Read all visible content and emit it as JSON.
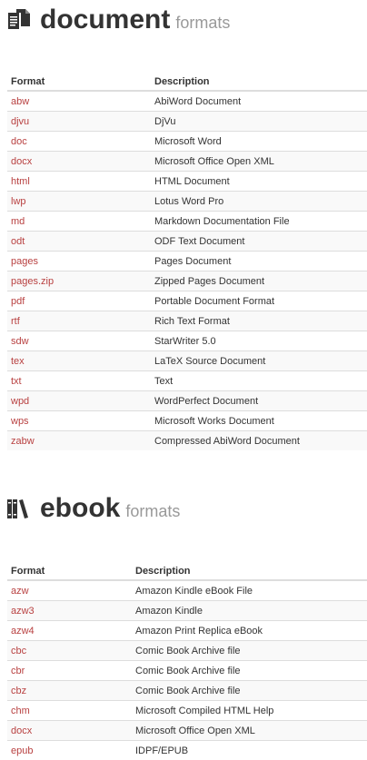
{
  "document": {
    "title": "document",
    "subtitle": "formats",
    "header_format": "Format",
    "header_description": "Description",
    "rows": [
      {
        "format": "abw",
        "description": "AbiWord Document"
      },
      {
        "format": "djvu",
        "description": "DjVu"
      },
      {
        "format": "doc",
        "description": "Microsoft Word"
      },
      {
        "format": "docx",
        "description": "Microsoft Office Open XML"
      },
      {
        "format": "html",
        "description": "HTML Document"
      },
      {
        "format": "lwp",
        "description": "Lotus Word Pro"
      },
      {
        "format": "md",
        "description": "Markdown Documentation File"
      },
      {
        "format": "odt",
        "description": "ODF Text Document"
      },
      {
        "format": "pages",
        "description": "Pages Document"
      },
      {
        "format": "pages.zip",
        "description": "Zipped Pages Document"
      },
      {
        "format": "pdf",
        "description": "Portable Document Format"
      },
      {
        "format": "rtf",
        "description": "Rich Text Format"
      },
      {
        "format": "sdw",
        "description": "StarWriter 5.0"
      },
      {
        "format": "tex",
        "description": "LaTeX Source Document"
      },
      {
        "format": "txt",
        "description": "Text"
      },
      {
        "format": "wpd",
        "description": "WordPerfect Document"
      },
      {
        "format": "wps",
        "description": "Microsoft Works Document"
      },
      {
        "format": "zabw",
        "description": "Compressed AbiWord Document"
      }
    ]
  },
  "ebook": {
    "title": "ebook",
    "subtitle": "formats",
    "header_format": "Format",
    "header_description": "Description",
    "rows": [
      {
        "format": "azw",
        "description": "Amazon Kindle eBook File"
      },
      {
        "format": "azw3",
        "description": "Amazon Kindle"
      },
      {
        "format": "azw4",
        "description": "Amazon Print Replica eBook"
      },
      {
        "format": "cbc",
        "description": "Comic Book Archive file"
      },
      {
        "format": "cbr",
        "description": "Comic Book Archive file"
      },
      {
        "format": "cbz",
        "description": "Comic Book Archive file"
      },
      {
        "format": "chm",
        "description": "Microsoft Compiled HTML Help"
      },
      {
        "format": "docx",
        "description": "Microsoft Office Open XML"
      },
      {
        "format": "epub",
        "description": "IDPF/EPUB"
      }
    ]
  },
  "icons": {
    "document": "document-icon",
    "ebook": "books-icon"
  },
  "colors": {
    "link": "#b84040",
    "heading": "#333333",
    "subtitle": "#999999",
    "border": "#dddddd"
  }
}
